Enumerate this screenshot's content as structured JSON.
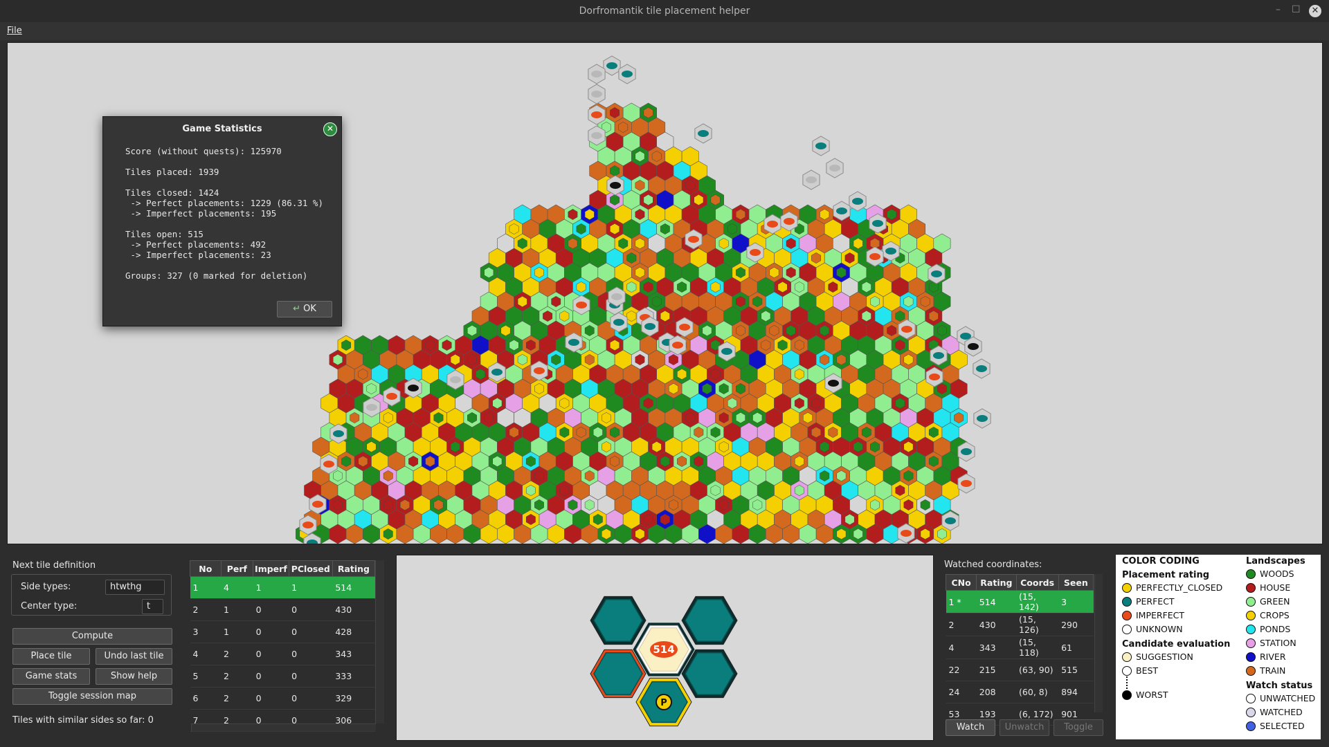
{
  "window": {
    "title": "Dorfromantik tile placement helper"
  },
  "menu": {
    "file": "File"
  },
  "dialog": {
    "title": "Game Statistics",
    "lines": [
      "Score (without quests): 125970",
      "",
      "Tiles placed: 1939",
      "",
      "Tiles closed: 1424",
      " -> Perfect placements: 1229 (86.31 %)",
      " -> Imperfect placements: 195",
      "",
      "Tiles open: 515",
      " -> Perfect placements: 492",
      " -> Imperfect placements: 23",
      "",
      "Groups: 327 (0 marked for deletion)"
    ],
    "ok": "OK"
  },
  "next_tile": {
    "title": "Next tile definition",
    "side_types_label": "Side types:",
    "side_types_value": "htwthg",
    "center_type_label": "Center type:",
    "center_type_value": "t",
    "compute": "Compute",
    "place_tile": "Place tile",
    "undo": "Undo last tile",
    "game_stats": "Game stats",
    "show_help": "Show help",
    "toggle_map": "Toggle session map",
    "similar": "Tiles with similar sides so far: 0"
  },
  "candidates": {
    "headers": [
      "No",
      "Perf",
      "Imperf",
      "PClosed",
      "Rating"
    ],
    "rows": [
      [
        "1",
        "4",
        "1",
        "1",
        "514"
      ],
      [
        "2",
        "1",
        "0",
        "0",
        "430"
      ],
      [
        "3",
        "1",
        "0",
        "0",
        "428"
      ],
      [
        "4",
        "2",
        "0",
        "0",
        "343"
      ],
      [
        "5",
        "2",
        "0",
        "0",
        "333"
      ],
      [
        "6",
        "2",
        "0",
        "0",
        "329"
      ],
      [
        "7",
        "2",
        "0",
        "0",
        "306"
      ]
    ]
  },
  "preview": {
    "center_value": "514",
    "marker": "P"
  },
  "watched": {
    "title": "Watched coordinates:",
    "headers": [
      "CNo",
      "Rating",
      "Coords",
      "Seen"
    ],
    "rows": [
      [
        "1 *",
        "514",
        "(15, 142)",
        "3"
      ],
      [
        "2",
        "430",
        "(15, 126)",
        "290"
      ],
      [
        "4",
        "343",
        "(15, 118)",
        "61"
      ],
      [
        "22",
        "215",
        "(63, 90)",
        "515"
      ],
      [
        "24",
        "208",
        "(60, 8)",
        "894"
      ],
      [
        "53",
        "193",
        "(6, 172)",
        "901"
      ]
    ],
    "watch": "Watch",
    "unwatch": "Unwatch",
    "toggle": "Toggle"
  },
  "legend": {
    "color_coding": "COLOR CODING",
    "placement_rating": "Placement rating",
    "ratings": [
      {
        "label": "PERFECTLY_CLOSED",
        "color": "#f5d000"
      },
      {
        "label": "PERFECT",
        "color": "#0a7d7d"
      },
      {
        "label": "IMPERFECT",
        "color": "#e84a1a"
      },
      {
        "label": "UNKNOWN",
        "color": "#ffffff"
      }
    ],
    "candidate_evaluation": "Candidate evaluation",
    "evals": [
      {
        "label": "SUGGESTION",
        "color": "#fbf0c4"
      },
      {
        "label": "BEST",
        "color": "#ffffff"
      },
      {
        "label": "WORST",
        "color": "#000000"
      }
    ],
    "landscapes": "Landscapes",
    "lands": [
      {
        "label": "WOODS",
        "color": "#1f8a1f"
      },
      {
        "label": "HOUSE",
        "color": "#b31d1d"
      },
      {
        "label": "GREEN",
        "color": "#90ee90"
      },
      {
        "label": "CROPS",
        "color": "#f5d000"
      },
      {
        "label": "PONDS",
        "color": "#22e5f0"
      },
      {
        "label": "STATION",
        "color": "#e6a0e6"
      },
      {
        "label": "RIVER",
        "color": "#1010c8"
      },
      {
        "label": "TRAIN",
        "color": "#d2691e"
      }
    ],
    "watch_status": "Watch status",
    "watch_items": [
      {
        "label": "UNWATCHED",
        "color": "#ffffff"
      },
      {
        "label": "WATCHED",
        "color": "#d8d8e8"
      },
      {
        "label": "SELECTED",
        "color": "#4060e0"
      }
    ]
  }
}
